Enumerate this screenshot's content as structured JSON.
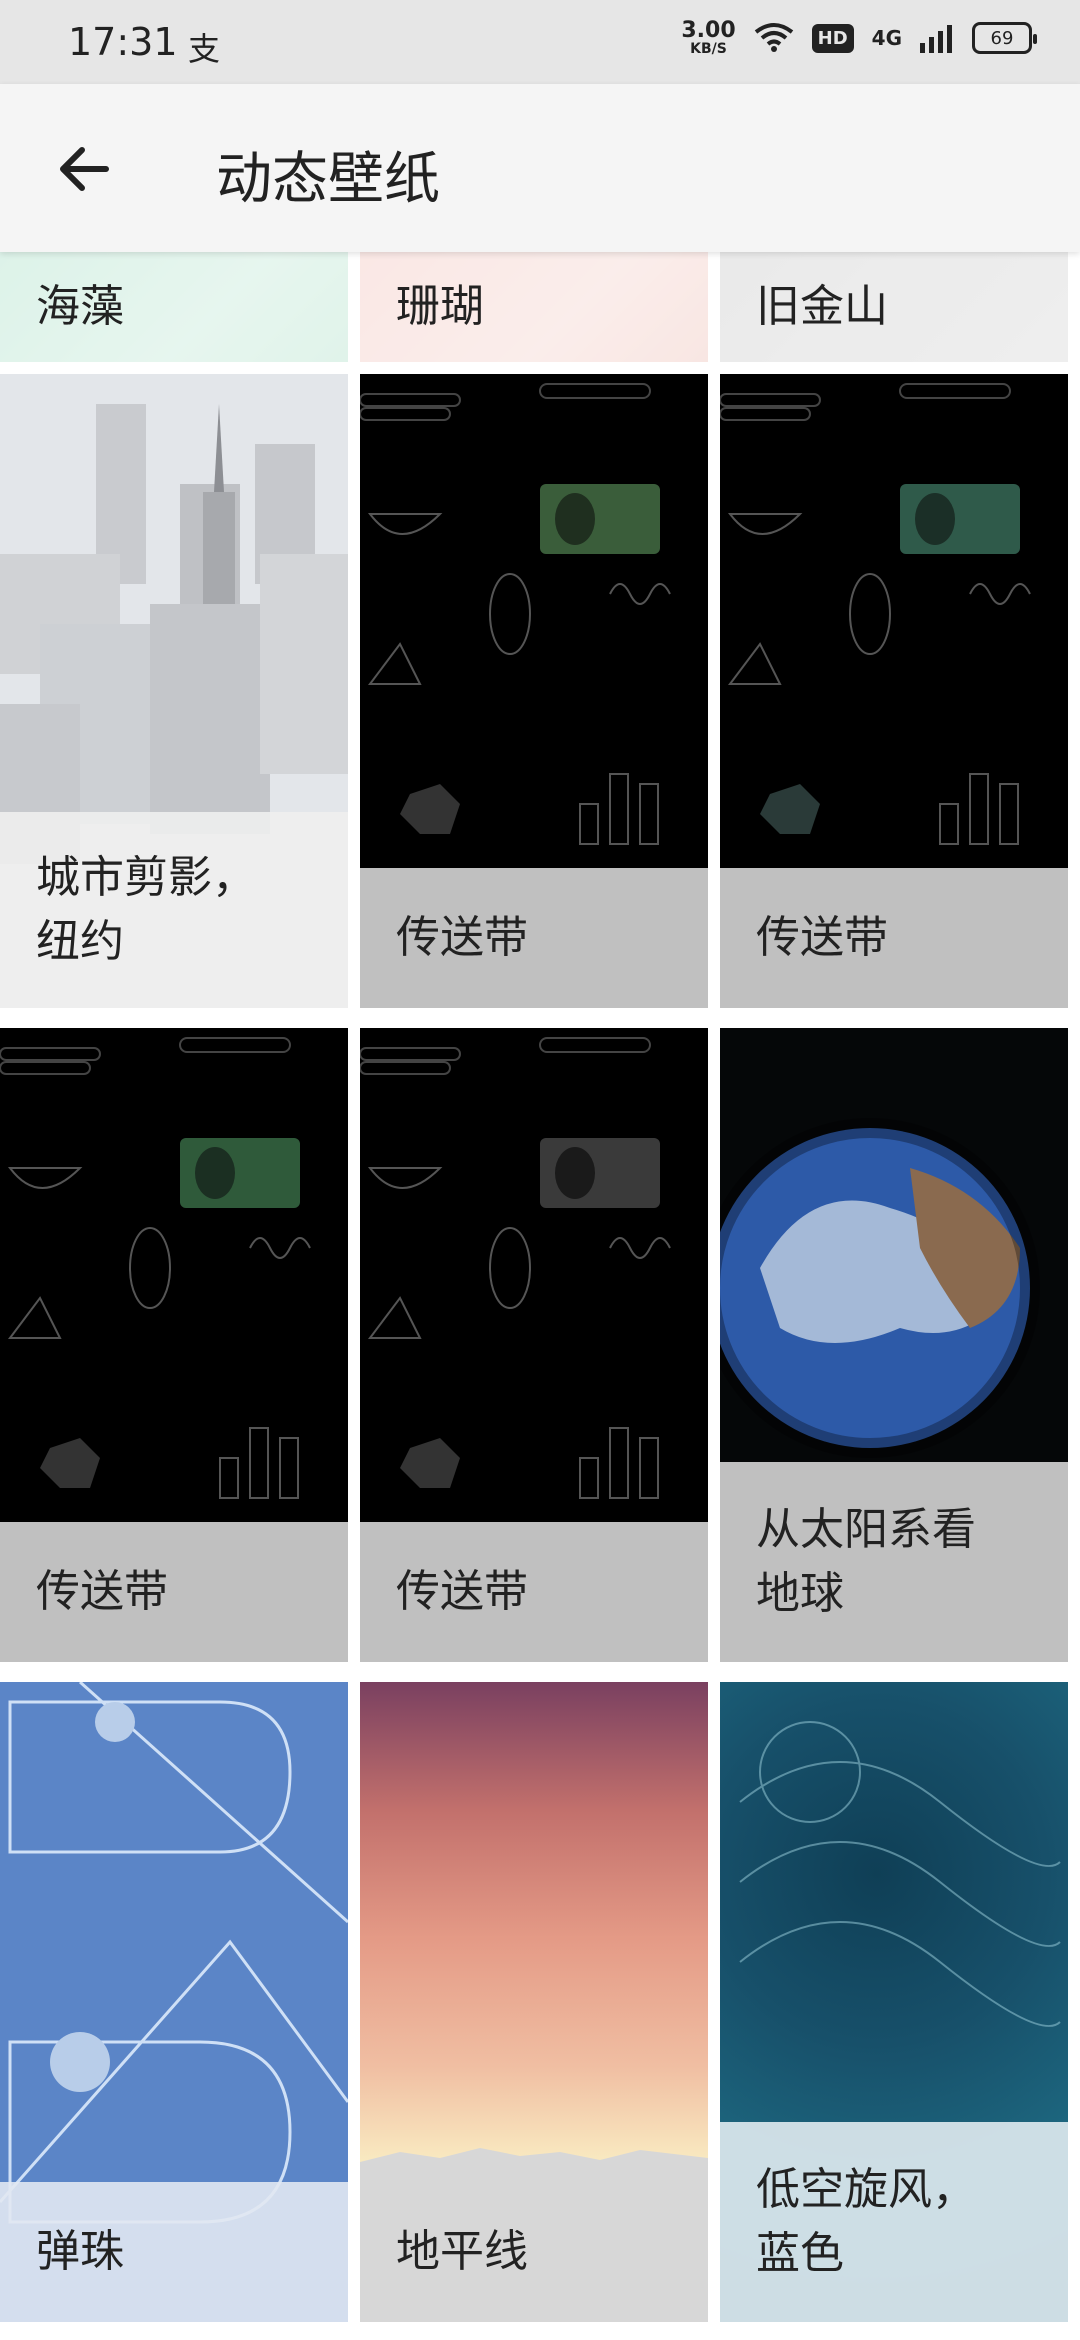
{
  "status": {
    "time": "17:31",
    "carrier_icon": "alipay-icon",
    "speed_value": "3.00",
    "speed_unit": "KB/S",
    "network": "4G",
    "hd": "HD",
    "battery": "69"
  },
  "header": {
    "title": "动态壁纸",
    "back_icon": "arrow-left-icon"
  },
  "wallpapers": [
    {
      "label": "海藻"
    },
    {
      "label": "珊瑚"
    },
    {
      "label": "旧金山"
    },
    {
      "label": "城市剪影，\n纽约"
    },
    {
      "label": "传送带"
    },
    {
      "label": "传送带"
    },
    {
      "label": "传送带"
    },
    {
      "label": "传送带"
    },
    {
      "label": "从太阳系看\n地球"
    },
    {
      "label": "弹珠"
    },
    {
      "label": "地平线"
    },
    {
      "label": "低空旋风，\n蓝色"
    }
  ],
  "colors": {
    "accent_green": "#3a5d3a",
    "marble_blue": "#5b85c7",
    "horizon_top": "#7a4060",
    "swirl_teal": "#17506a"
  }
}
